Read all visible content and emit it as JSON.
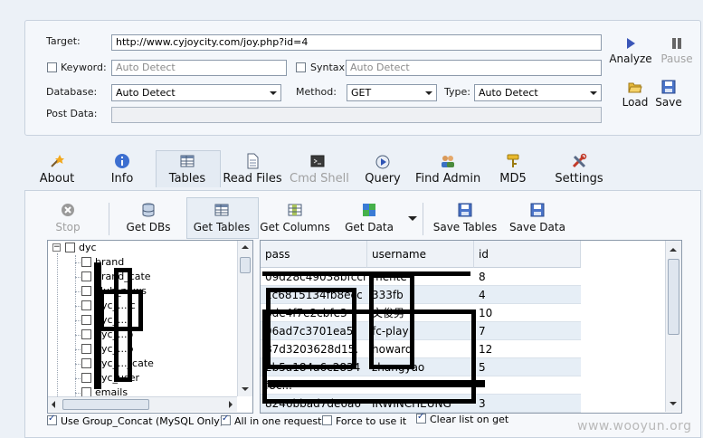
{
  "form": {
    "target_label": "Target:",
    "target_value": "http://www.cyjoycity.com/joy.php?id=4",
    "keyword_label": "Keyword:",
    "keyword_placeholder": "Auto Detect",
    "syntax_label": "Syntax:",
    "syntax_placeholder": "Auto Detect",
    "database_label": "Database:",
    "database_value": "Auto Detect",
    "method_label": "Method:",
    "method_value": "GET",
    "type_label": "Type:",
    "type_value": "Auto Detect",
    "postdata_label": "Post Data:"
  },
  "actions": {
    "analyze": "Analyze",
    "pause": "Pause",
    "load": "Load",
    "save": "Save"
  },
  "tabs": [
    {
      "label": "About",
      "icon": "wand-icon"
    },
    {
      "label": "Info",
      "icon": "info-icon"
    },
    {
      "label": "Tables",
      "icon": "table-icon"
    },
    {
      "label": "Read Files",
      "icon": "document-icon"
    },
    {
      "label": "Cmd Shell",
      "icon": "terminal-icon"
    },
    {
      "label": "Query",
      "icon": "query-icon"
    },
    {
      "label": "Find Admin",
      "icon": "users-icon"
    },
    {
      "label": "MD5",
      "icon": "key-icon"
    },
    {
      "label": "Settings",
      "icon": "tools-icon"
    }
  ],
  "toolbar": {
    "stop": "Stop",
    "get_dbs": "Get DBs",
    "get_tables": "Get Tables",
    "get_columns": "Get Columns",
    "get_data": "Get Data",
    "save_tables": "Save Tables",
    "save_data": "Save Data"
  },
  "tree": {
    "root": "dyc",
    "items": [
      "brand",
      "brand_cate",
      "club_news",
      "dyc_...ic",
      "dyc_...",
      "dyc_...o",
      "dyc_...p",
      "dyc_..._cate",
      "dyc_user",
      "emails"
    ]
  },
  "grid": {
    "columns": [
      "pass",
      "username",
      "id"
    ],
    "rows": [
      [
        "09d28c49038bfccm",
        "mente",
        "8"
      ],
      [
        "1c6815134fb8ecc",
        "333fb",
        "4"
      ],
      [
        "bde4f7e2cbfe3",
        "文俊男",
        "10"
      ],
      [
        "96ad7c3701ea5",
        "fc-play",
        "7"
      ],
      [
        "87d3203628d15.",
        "howard",
        "12"
      ],
      [
        "2b5a184a6c2834",
        "zhangyao",
        "5"
      ],
      [
        "f8c...",
        "",
        ""
      ],
      [
        "8246bbad7de6a6",
        "IRWINCHEUNG",
        "3"
      ]
    ]
  },
  "options": {
    "group_concat": "Use Group_Concat (MySQL Only)",
    "all_in_one": "All in one request.",
    "force": "Force to use it",
    "clear_list": "Clear list on get"
  },
  "watermark": "www.wooyun.org"
}
